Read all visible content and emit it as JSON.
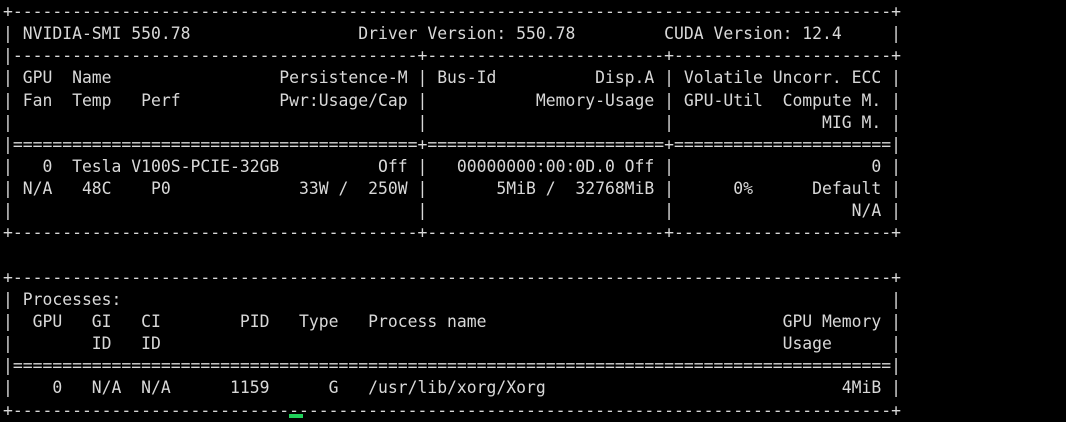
{
  "terminal": {
    "lines": [
      "+-----------------------------------------------------------------------------------------+",
      "| NVIDIA-SMI 550.78                 Driver Version: 550.78         CUDA Version: 12.4     |",
      "|-----------------------------------------+------------------------+----------------------+",
      "| GPU  Name                 Persistence-M | Bus-Id          Disp.A | Volatile Uncorr. ECC |",
      "| Fan  Temp   Perf          Pwr:Usage/Cap |           Memory-Usage | GPU-Util  Compute M. |",
      "|                                         |                        |               MIG M. |",
      "|=========================================+========================+======================|",
      "|   0  Tesla V100S-PCIE-32GB          Off |   00000000:00:0D.0 Off |                    0 |",
      "| N/A   48C    P0             33W /  250W |       5MiB /  32768MiB |      0%      Default |",
      "|                                         |                        |                  N/A |",
      "+-----------------------------------------+------------------------+----------------------+",
      "",
      "+-----------------------------------------------------------------------------------------+",
      "| Processes:                                                                              |",
      "|  GPU   GI   CI        PID   Type   Process name                              GPU Memory |",
      "|        ID   ID                                                               Usage      |",
      "|=========================================================================================|",
      "|    0   N/A  N/A      1159      G   /usr/lib/xorg/Xorg                              4MiB |",
      "+-----------------------------------------------------------------------------------------+"
    ]
  },
  "colors": {
    "background": "#000000",
    "text": "#d8d8d8",
    "cursor": "#1fd15a"
  }
}
